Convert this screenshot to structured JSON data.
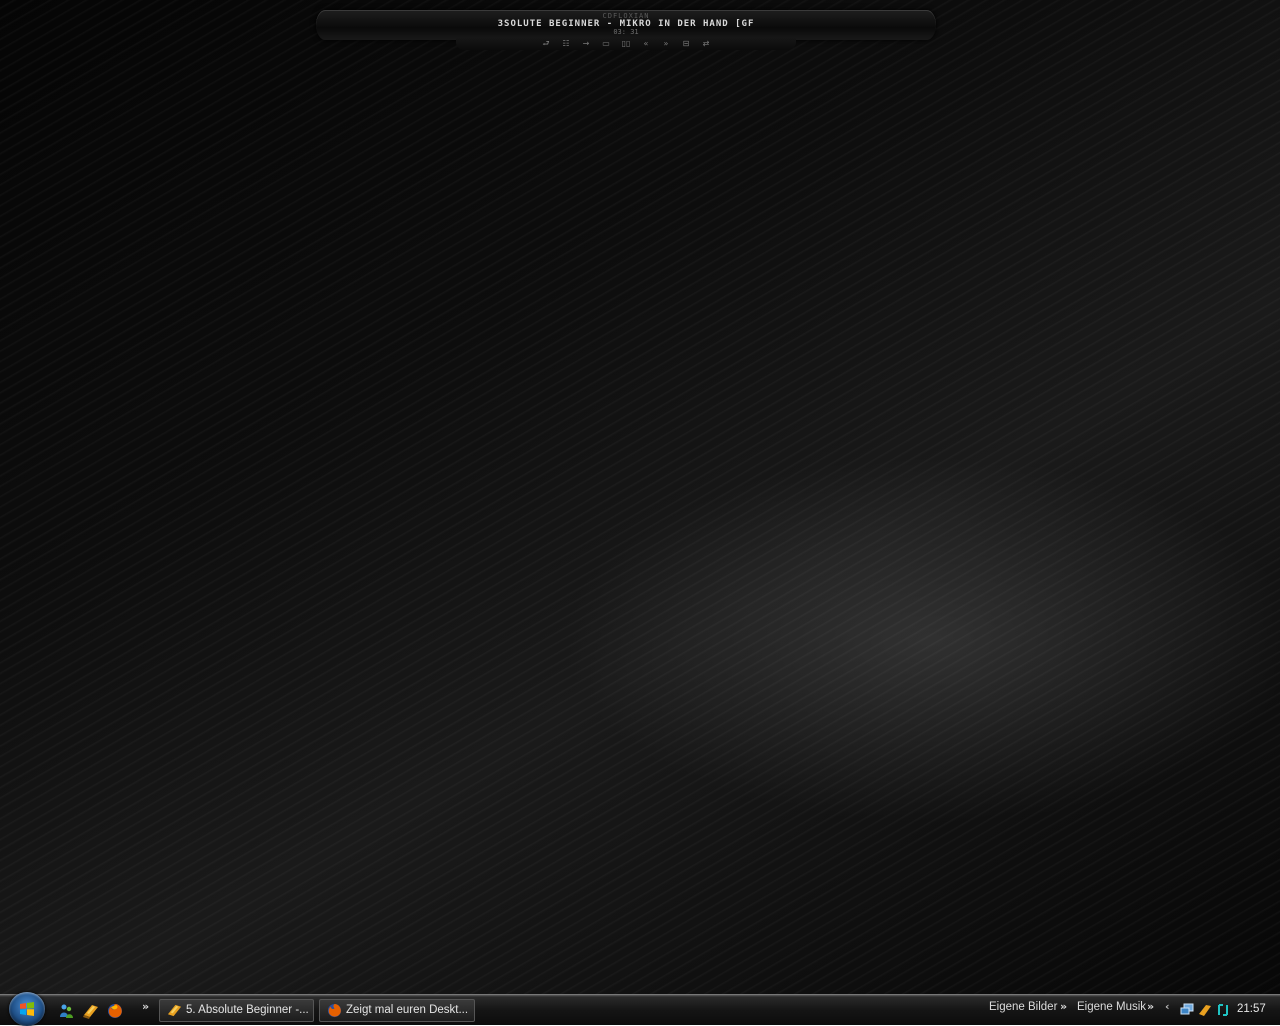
{
  "player": {
    "artist_small": "CDFLOXIAN",
    "track_title": "3SOLUTE BEGINNER - MIKRO IN DER HAND [GF",
    "time": "03: 31",
    "controls": [
      "repeat-icon",
      "equalizer-icon",
      "play-icon",
      "stop-icon",
      "pause-icon",
      "previous-icon",
      "next-icon",
      "playlist-icon",
      "shuffle-icon"
    ]
  },
  "taskbar": {
    "quick_launch_more": "»",
    "tasks": [
      {
        "label": "5. Absolute Beginner -...",
        "icon": "winamp-icon"
      },
      {
        "label": "Zeigt mal euren Deskt...",
        "icon": "firefox-icon"
      }
    ],
    "toolbars": [
      {
        "label": "Eigene Bilder",
        "more": "»"
      },
      {
        "label": "Eigene Musik",
        "more": "»"
      }
    ],
    "tray_expand": "‹",
    "clock": "21:57"
  },
  "colors": {
    "taskbar": "#151515",
    "start_orb": "#1f4f86"
  }
}
